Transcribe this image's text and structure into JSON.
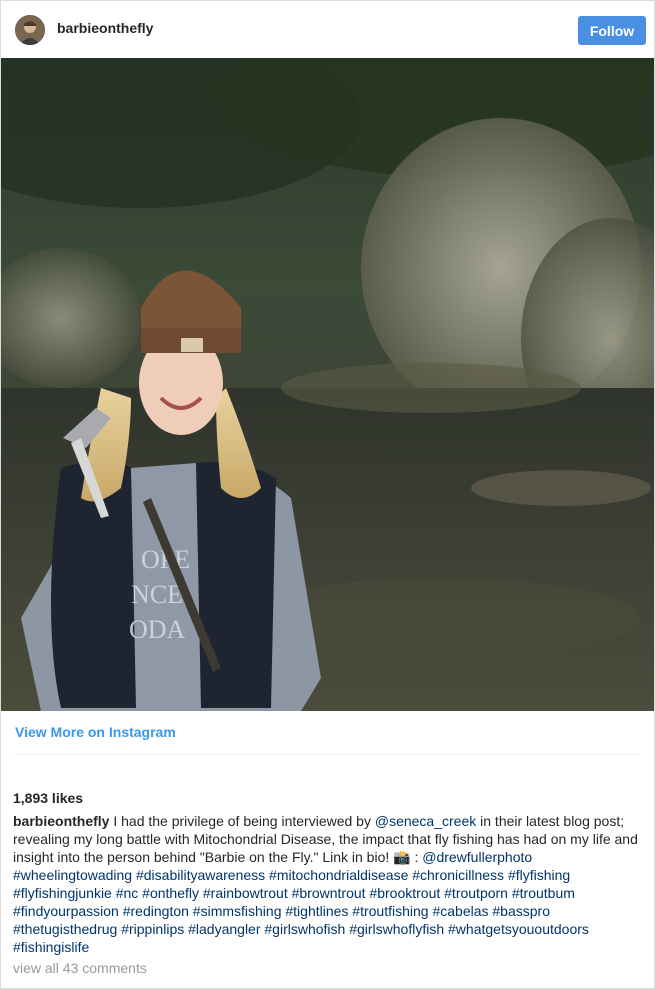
{
  "header": {
    "username": "barbieonthefly",
    "follow_label": "Follow"
  },
  "view_more_label": "View More on Instagram",
  "likes": "1,893 likes",
  "caption": {
    "username": "barbieonthefly",
    "part1": " I had the privilege of being interviewed by ",
    "mention1": "@seneca_creek",
    "part2": " in their latest blog post; revealing my long battle with Mitochondrial Disease, the impact that fly fishing has had on my life and insight into the person behind \"Barbie on the Fly.\" Link in bio! 📸 : ",
    "mention2": "@drewfullerphoto",
    "hashtags": "#wheelingtowading #disabilityawareness #mitochondrialdisease #chronicillness #flyfishing #flyfishingjunkie #nc #onthefly #rainbowtrout #browntrout #brooktrout #troutporn #troutbum #findyourpassion #redington #simmsfishing #tightlines #troutfishing #cabelas #basspro #thetugisthedrug #rippinlips #ladyangler #girlswhofish #girlswhoflyfish #whatgetsyououtdoors #fishingislife"
  },
  "comments_link": "view all 43 comments",
  "colors": {
    "follow_button": "#4a90e2",
    "link_blue": "#3897f0",
    "hashtag": "#003569"
  },
  "icons": {
    "avatar": "avatar",
    "camera_emoji": "camera-emoji"
  }
}
